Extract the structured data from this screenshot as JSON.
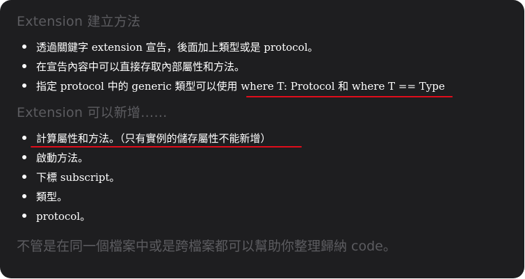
{
  "slide": {
    "section1": {
      "heading": "Extension 建立方法",
      "bullets": [
        "透過關鍵字 extension 宣告，後面加上類型或是 protocol。",
        "在宣告內容中可以直接存取內部屬性和方法。",
        "指定 protocol 中的 generic 類型可以使用 where T: Protocol 和 where T == Type"
      ]
    },
    "section2": {
      "heading": "Extension 可以新增……",
      "bullets": [
        "計算屬性和方法。（只有實例的儲存屬性不能新增）",
        "啟動方法。",
        "下標 subscript。",
        "類型。",
        "protocol。"
      ]
    },
    "footer": "不管是在同一個檔案中或是跨檔案都可以幫助你整理歸納 code。"
  },
  "colors": {
    "background": "#1e1e20",
    "heading": "#5c5c60",
    "body_text": "#ffffff",
    "underline": "#e10d1b"
  }
}
